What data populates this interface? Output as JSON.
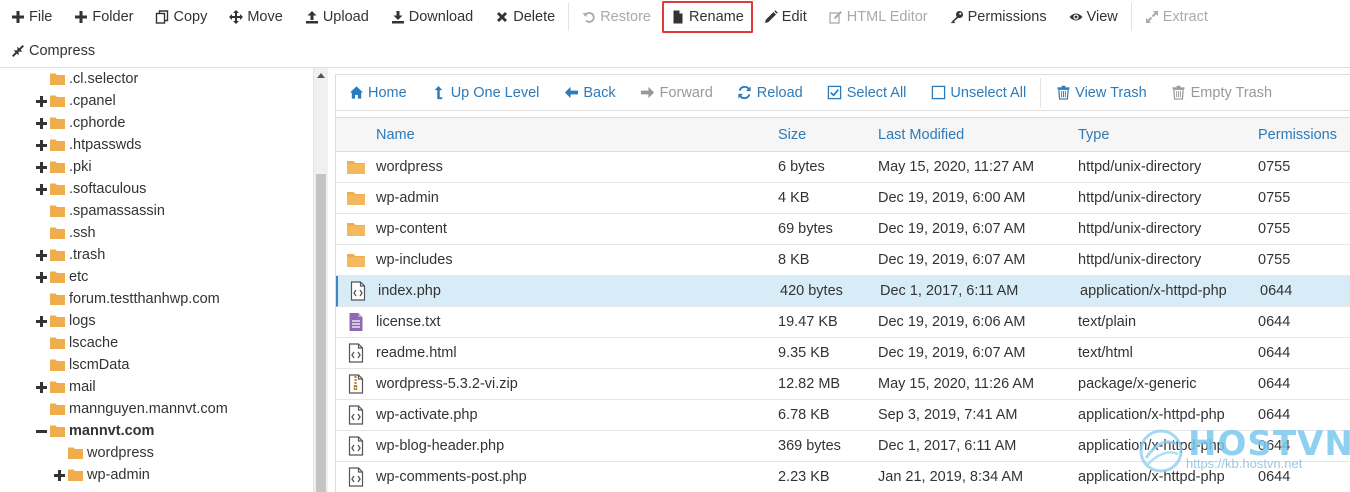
{
  "toolbar": {
    "row1": [
      {
        "label": "File",
        "icon": "plus-icon",
        "disabled": false
      },
      {
        "label": "Folder",
        "icon": "plus-icon",
        "disabled": false
      },
      {
        "label": "Copy",
        "icon": "copy-icon",
        "disabled": false
      },
      {
        "label": "Move",
        "icon": "move-icon",
        "disabled": false
      },
      {
        "label": "Upload",
        "icon": "upload-icon",
        "disabled": false
      },
      {
        "label": "Download",
        "icon": "download-icon",
        "disabled": false
      },
      {
        "label": "Delete",
        "icon": "times-icon",
        "disabled": false
      },
      {
        "label": "Restore",
        "icon": "undo-icon",
        "disabled": true
      },
      {
        "label": "Rename",
        "icon": "file-icon",
        "disabled": false,
        "highlighted": true
      },
      {
        "label": "Edit",
        "icon": "pencil-icon",
        "disabled": false
      },
      {
        "label": "HTML Editor",
        "icon": "edit-icon",
        "disabled": true
      },
      {
        "label": "Permissions",
        "icon": "key-icon",
        "disabled": false
      },
      {
        "label": "View",
        "icon": "eye-icon",
        "disabled": false
      },
      {
        "label": "Extract",
        "icon": "expand-icon",
        "disabled": true
      }
    ],
    "row2": [
      {
        "label": "Compress",
        "icon": "compress-icon",
        "disabled": false
      }
    ]
  },
  "tree": [
    {
      "label": ".cl.selector",
      "toggle": "",
      "depth": 0,
      "bold": false
    },
    {
      "label": ".cpanel",
      "toggle": "+",
      "depth": 0,
      "bold": false
    },
    {
      "label": ".cphorde",
      "toggle": "+",
      "depth": 0,
      "bold": false
    },
    {
      "label": ".htpasswds",
      "toggle": "+",
      "depth": 0,
      "bold": false
    },
    {
      "label": ".pki",
      "toggle": "+",
      "depth": 0,
      "bold": false
    },
    {
      "label": ".softaculous",
      "toggle": "+",
      "depth": 0,
      "bold": false
    },
    {
      "label": ".spamassassin",
      "toggle": "",
      "depth": 0,
      "bold": false
    },
    {
      "label": ".ssh",
      "toggle": "",
      "depth": 0,
      "bold": false
    },
    {
      "label": ".trash",
      "toggle": "+",
      "depth": 0,
      "bold": false
    },
    {
      "label": "etc",
      "toggle": "+",
      "depth": 0,
      "bold": false
    },
    {
      "label": "forum.testthanhwp.com",
      "toggle": "",
      "depth": 0,
      "bold": false
    },
    {
      "label": "logs",
      "toggle": "+",
      "depth": 0,
      "bold": false
    },
    {
      "label": "lscache",
      "toggle": "",
      "depth": 0,
      "bold": false
    },
    {
      "label": "lscmData",
      "toggle": "",
      "depth": 0,
      "bold": false
    },
    {
      "label": "mail",
      "toggle": "+",
      "depth": 0,
      "bold": false
    },
    {
      "label": "mannguyen.mannvt.com",
      "toggle": "",
      "depth": 0,
      "bold": false
    },
    {
      "label": "mannvt.com",
      "toggle": "-",
      "depth": 0,
      "bold": true
    },
    {
      "label": "wordpress",
      "toggle": "",
      "depth": 1,
      "bold": false
    },
    {
      "label": "wp-admin",
      "toggle": "+",
      "depth": 1,
      "bold": false
    }
  ],
  "nav": [
    {
      "label": "Home",
      "icon": "home-icon",
      "disabled": false
    },
    {
      "label": "Up One Level",
      "icon": "level-up-icon",
      "disabled": false
    },
    {
      "label": "Back",
      "icon": "arrow-left-icon",
      "disabled": false
    },
    {
      "label": "Forward",
      "icon": "arrow-right-icon",
      "disabled": true
    },
    {
      "label": "Reload",
      "icon": "refresh-icon",
      "disabled": false
    },
    {
      "label": "Select All",
      "icon": "checkbox-checked-icon",
      "disabled": false
    },
    {
      "label": "Unselect All",
      "icon": "checkbox-empty-icon",
      "disabled": false
    },
    {
      "label": "View Trash",
      "icon": "trash-icon",
      "disabled": false
    },
    {
      "label": "Empty Trash",
      "icon": "trash-icon",
      "disabled": true
    }
  ],
  "table": {
    "headers": {
      "name": "Name",
      "size": "Size",
      "modified": "Last Modified",
      "type": "Type",
      "permissions": "Permissions"
    },
    "rows": [
      {
        "icon": "folder-icon",
        "name": "wordpress",
        "size": "6 bytes",
        "modified": "May 15, 2020, 11:27 AM",
        "type": "httpd/unix-directory",
        "perm": "0755",
        "selected": false
      },
      {
        "icon": "folder-icon",
        "name": "wp-admin",
        "size": "4 KB",
        "modified": "Dec 19, 2019, 6:00 AM",
        "type": "httpd/unix-directory",
        "perm": "0755",
        "selected": false
      },
      {
        "icon": "folder-icon",
        "name": "wp-content",
        "size": "69 bytes",
        "modified": "Dec 19, 2019, 6:07 AM",
        "type": "httpd/unix-directory",
        "perm": "0755",
        "selected": false
      },
      {
        "icon": "folder-icon",
        "name": "wp-includes",
        "size": "8 KB",
        "modified": "Dec 19, 2019, 6:07 AM",
        "type": "httpd/unix-directory",
        "perm": "0755",
        "selected": false
      },
      {
        "icon": "code-file-icon",
        "name": "index.php",
        "size": "420 bytes",
        "modified": "Dec 1, 2017, 6:11 AM",
        "type": "application/x-httpd-php",
        "perm": "0644",
        "selected": true
      },
      {
        "icon": "text-file-icon",
        "name": "license.txt",
        "size": "19.47 KB",
        "modified": "Dec 19, 2019, 6:06 AM",
        "type": "text/plain",
        "perm": "0644",
        "selected": false
      },
      {
        "icon": "code-file-icon",
        "name": "readme.html",
        "size": "9.35 KB",
        "modified": "Dec 19, 2019, 6:07 AM",
        "type": "text/html",
        "perm": "0644",
        "selected": false
      },
      {
        "icon": "zip-file-icon",
        "name": "wordpress-5.3.2-vi.zip",
        "size": "12.82 MB",
        "modified": "May 15, 2020, 11:26 AM",
        "type": "package/x-generic",
        "perm": "0644",
        "selected": false
      },
      {
        "icon": "code-file-icon",
        "name": "wp-activate.php",
        "size": "6.78 KB",
        "modified": "Sep 3, 2019, 7:41 AM",
        "type": "application/x-httpd-php",
        "perm": "0644",
        "selected": false
      },
      {
        "icon": "code-file-icon",
        "name": "wp-blog-header.php",
        "size": "369 bytes",
        "modified": "Dec 1, 2017, 6:11 AM",
        "type": "application/x-httpd-php",
        "perm": "0644",
        "selected": false
      },
      {
        "icon": "code-file-icon",
        "name": "wp-comments-post.php",
        "size": "2.23 KB",
        "modified": "Jan 21, 2019, 8:34 AM",
        "type": "application/x-httpd-php",
        "perm": "0644",
        "selected": false
      }
    ]
  },
  "watermark": {
    "brand": "HOSTVN",
    "url": "https://kb.hostvn.net"
  },
  "colors": {
    "link": "#2c7ab8",
    "folder": "#f0ad4e",
    "selected_row": "#d8ecf8",
    "highlight_border": "#e03a3a"
  }
}
